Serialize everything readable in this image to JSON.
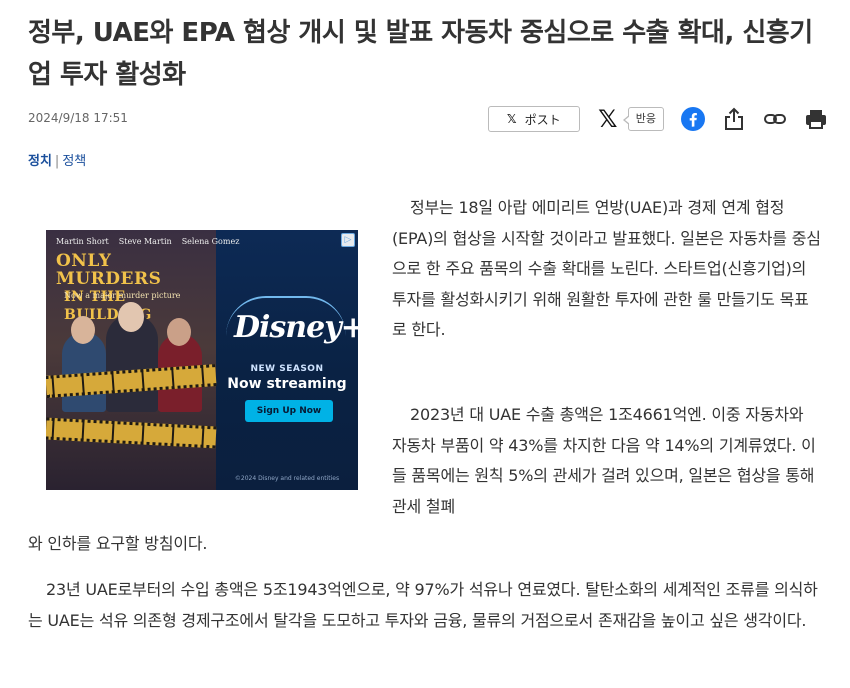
{
  "article": {
    "title": "정부, UAE와 EPA 협상 개시 및 발표 자동차 중심으로 수출 확대, 신흥기업 투자 활성화",
    "date": "2024/9/18 17:51",
    "category_main": "정치",
    "category_separator": "|",
    "category_sub": "정책"
  },
  "share": {
    "post_x": "𝕏",
    "post_label": "ポスト",
    "x_logo": "𝕏",
    "reply_label": "반응",
    "icons": [
      "x-icon",
      "facebook-icon",
      "share-icon",
      "link-icon",
      "print-icon"
    ]
  },
  "ad": {
    "cast": [
      "Martin Short",
      "Steve Martin",
      "Selena Gomez"
    ],
    "show_line1": "ONLY MURDERS",
    "show_line2": "IN THE BUILDING",
    "tagline": "Now a major      murder picture",
    "brand": "Disney+",
    "new_season": "NEW SEASON",
    "streaming": "Now streaming",
    "cta": "Sign Up Now",
    "copyright": "©2024 Disney and related entities",
    "ad_choice": "▷"
  },
  "body": {
    "p1": "정부는 18일 아랍 에미리트 연방(UAE)과 경제 연계 협정(EPA)의 협상을 시작할 것이라고 발표했다. 일본은 자동차를 중심으로 한 주요 품목의 수출 확대를 노린다. 스타트업(신흥기업)의 투자를 활성화시키기 위해 원활한 투자에 관한 룰 만들기도 목표로 한다.",
    "p2": "2023년 대 UAE 수출 총액은 1조4661억엔. 이중 자동차와 자동차 부품이 약 43%를 차지한 다음 약 14%의 기계류였다. 이들 품목에는 원칙 5%의 관세가 걸려 있으며, 일본은 협상을 통해 관세 철폐",
    "p2_tail": "와 인하를 요구할 방침이다.",
    "p3": "23년 UAE로부터의 수입 총액은 5조1943억엔으로, 약 97%가 석유나 연료였다. 탈탄소화의 세계적인 조류를 의식하는 UAE는 석유 의존형 경제구조에서 탈각을 도모하고 투자와 금융, 물류의 거점으로서 존재감을 높이고 싶은 생각이다."
  },
  "colors": {
    "category": "#1a4f9c",
    "facebook": "#1877f2",
    "ad_background": "#0d2a55",
    "ad_cta": "#00b2e6"
  }
}
